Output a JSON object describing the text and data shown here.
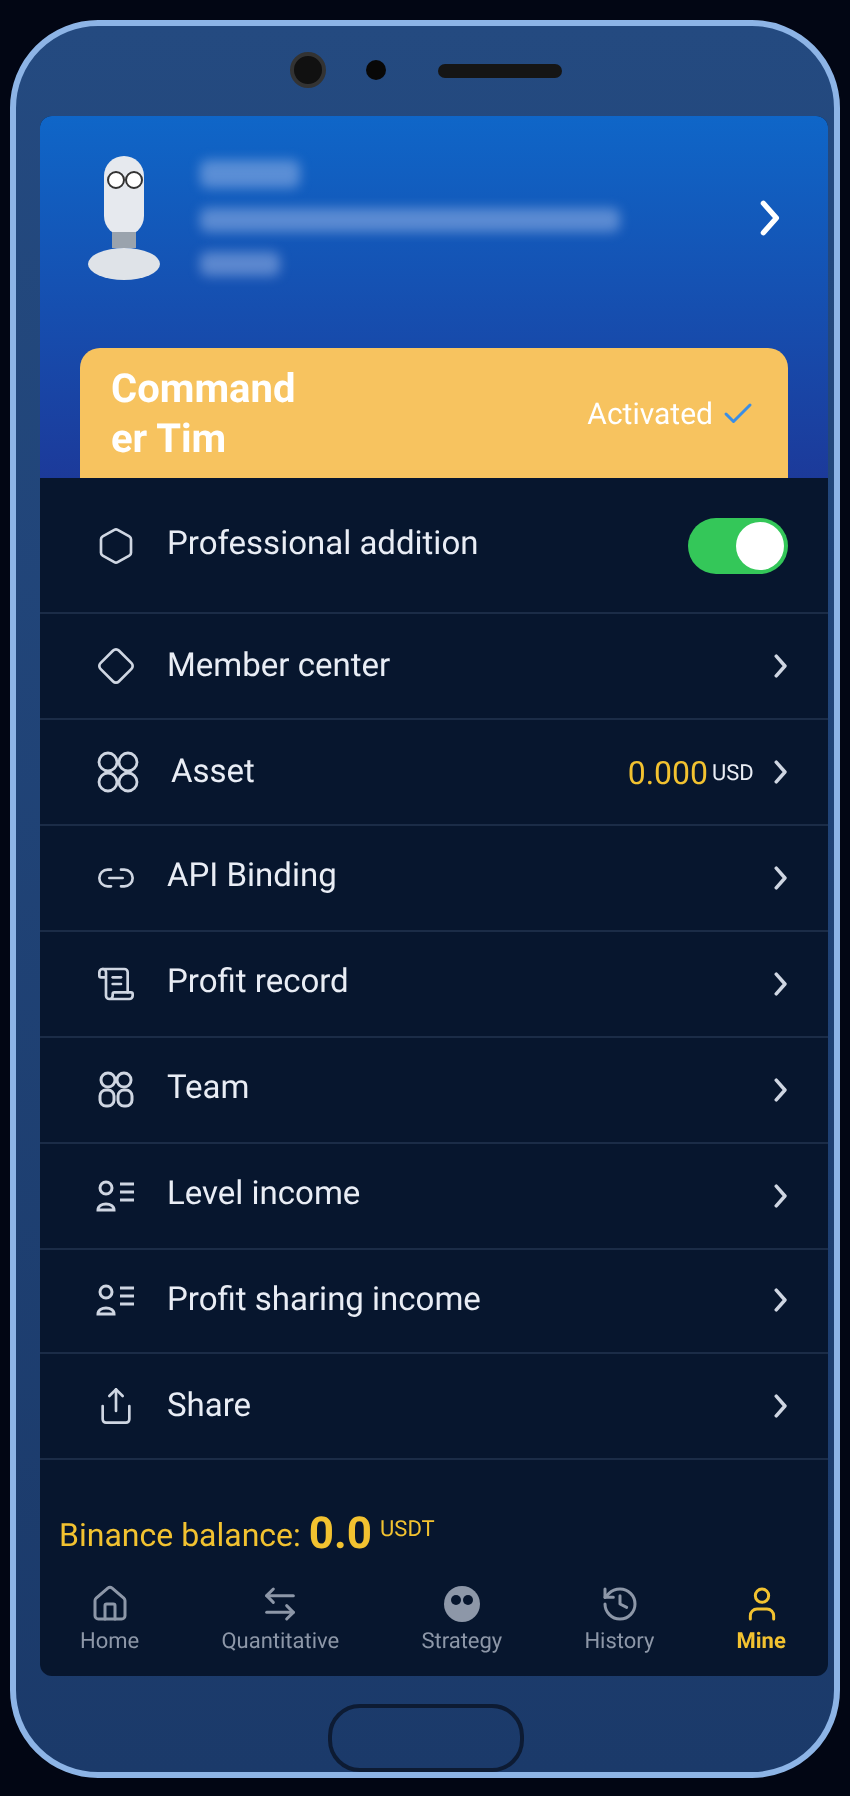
{
  "membership": {
    "title": "Command er Tim",
    "status": "Activated",
    "activated": true
  },
  "menu": [
    {
      "kind": "toggle",
      "label": "Professional addition",
      "on": true
    },
    {
      "kind": "link",
      "label": "Member center"
    },
    {
      "kind": "value",
      "label": "Asset",
      "value": "0.000",
      "unit": "USD"
    },
    {
      "kind": "link",
      "label": "API Binding"
    },
    {
      "kind": "link",
      "label": "Profit record"
    },
    {
      "kind": "link",
      "label": "Team"
    },
    {
      "kind": "link",
      "label": "Level income"
    },
    {
      "kind": "link",
      "label": "Profit sharing income"
    },
    {
      "kind": "link",
      "label": "Share"
    }
  ],
  "balance": {
    "label": "Binance balance:",
    "value": "0.0",
    "unit": "USDT"
  },
  "nav": [
    {
      "label": "Home",
      "selected": false
    },
    {
      "label": "Quantitative",
      "selected": false
    },
    {
      "label": "Strategy",
      "selected": false
    },
    {
      "label": "History",
      "selected": false
    },
    {
      "label": "Mine",
      "selected": true
    }
  ]
}
